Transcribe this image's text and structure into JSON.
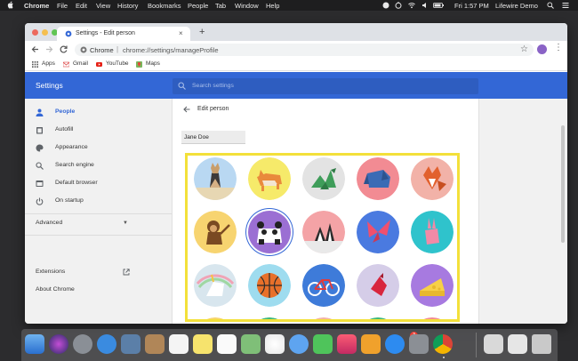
{
  "menubar": {
    "items": [
      "Chrome",
      "File",
      "Edit",
      "View",
      "History",
      "Bookmarks",
      "People",
      "Tab",
      "Window",
      "Help"
    ],
    "clock": "Fri 1:57 PM",
    "user": "Lifewire Demo"
  },
  "browser": {
    "tab_title": "Settings - Edit person",
    "site_label": "Chrome",
    "url": "chrome://settings/manageProfile",
    "bookmarks": [
      "Apps",
      "Gmail",
      "YouTube",
      "Maps"
    ]
  },
  "settings": {
    "title": "Settings",
    "search_placeholder": "Search settings",
    "sidebar": {
      "items": [
        {
          "label": "People",
          "icon": "person-icon",
          "active": true
        },
        {
          "label": "Autofill",
          "icon": "clipboard-icon",
          "active": false
        },
        {
          "label": "Appearance",
          "icon": "palette-icon",
          "active": false
        },
        {
          "label": "Search engine",
          "icon": "search-icon",
          "active": false
        },
        {
          "label": "Default browser",
          "icon": "browser-icon",
          "active": false
        },
        {
          "label": "On startup",
          "icon": "power-icon",
          "active": false
        }
      ],
      "advanced": "Advanced",
      "extensions": "Extensions",
      "about": "About Chrome"
    },
    "edit_person": {
      "title": "Edit person",
      "name_value": "Jane Doe"
    }
  },
  "avatars": [
    {
      "name": "cat",
      "bg": "#b9d8f2"
    },
    {
      "name": "corgi",
      "bg": "#f6ea6a"
    },
    {
      "name": "dragon",
      "bg": "#e3e3e3"
    },
    {
      "name": "elephant",
      "bg": "#f28b93"
    },
    {
      "name": "fox",
      "bg": "#f2b2a8"
    },
    {
      "name": "monkey",
      "bg": "#f7d470"
    },
    {
      "name": "panda",
      "bg": "#9b6fd3",
      "selected": true
    },
    {
      "name": "penguin",
      "bg": "#f4a3a6"
    },
    {
      "name": "butterfly",
      "bg": "#4a7ae0"
    },
    {
      "name": "rabbit",
      "bg": "#2fc3cc"
    },
    {
      "name": "unicorn",
      "bg": "#d8e6ee"
    },
    {
      "name": "basketball",
      "bg": "#9edcef"
    },
    {
      "name": "bicycle",
      "bg": "#3e7bd9"
    },
    {
      "name": "bird",
      "bg": "#d5cde8"
    },
    {
      "name": "cheese",
      "bg": "#a77ae0"
    }
  ],
  "dock": {
    "app_store_badge": "3"
  },
  "colors": {
    "accent": "#3367d6",
    "highlight_border": "#f3e03a"
  }
}
